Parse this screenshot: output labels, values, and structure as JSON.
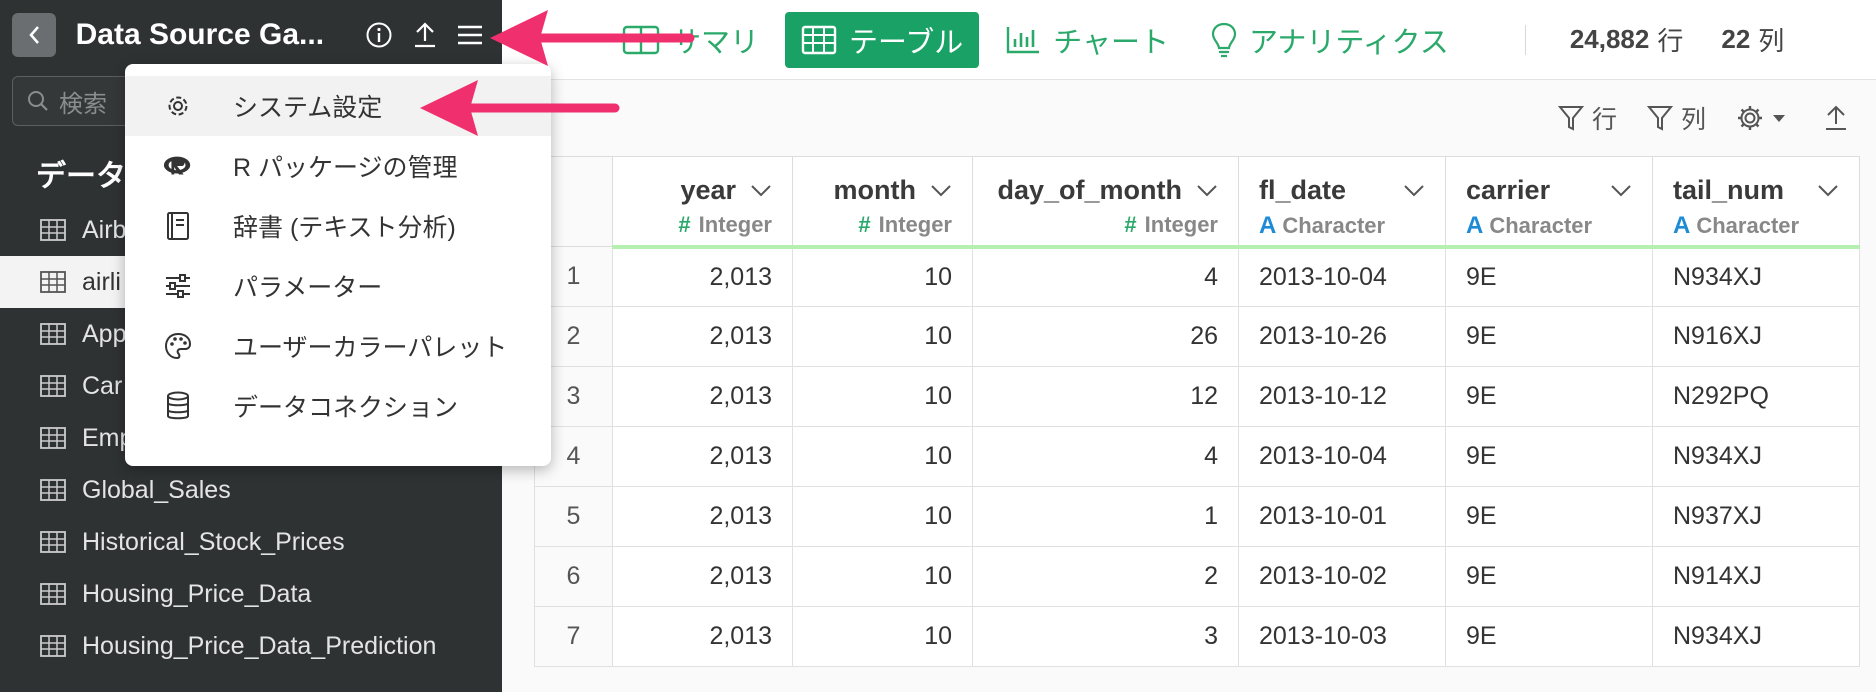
{
  "sidebar": {
    "title": "Data Source Ga...",
    "search_placeholder": "検索",
    "section_label": "データ",
    "items": [
      {
        "label": "Airb"
      },
      {
        "label": "airli"
      },
      {
        "label": "App"
      },
      {
        "label": "Car"
      },
      {
        "label": "Emp"
      },
      {
        "label": "Global_Sales"
      },
      {
        "label": "Historical_Stock_Prices"
      },
      {
        "label": "Housing_Price_Data"
      },
      {
        "label": "Housing_Price_Data_Prediction"
      }
    ]
  },
  "menu": {
    "items": [
      {
        "label": "システム設定",
        "icon": "gear-icon"
      },
      {
        "label": "R パッケージの管理",
        "icon": "r-logo-icon"
      },
      {
        "label": "辞書 (テキスト分析)",
        "icon": "book-icon"
      },
      {
        "label": "パラメーター",
        "icon": "sliders-icon"
      },
      {
        "label": "ユーザーカラーパレット",
        "icon": "palette-icon"
      },
      {
        "label": "データコネクション",
        "icon": "database-icon"
      }
    ]
  },
  "tabs": [
    {
      "label": "サマリ",
      "icon": "summary-icon"
    },
    {
      "label": "テーブル",
      "icon": "table-icon",
      "active": true
    },
    {
      "label": "チャート",
      "icon": "bar-chart-icon"
    },
    {
      "label": "アナリティクス",
      "icon": "bulb-icon"
    }
  ],
  "stats": {
    "rows_value": "24,882",
    "rows_unit": "行",
    "cols_value": "22",
    "cols_unit": "列"
  },
  "toolbar": {
    "row_filter": "行",
    "col_filter": "列"
  },
  "table": {
    "columns": [
      {
        "name": "year",
        "type": "Integer",
        "type_symbol": "#"
      },
      {
        "name": "month",
        "type": "Integer",
        "type_symbol": "#"
      },
      {
        "name": "day_of_month",
        "type": "Integer",
        "type_symbol": "#"
      },
      {
        "name": "fl_date",
        "type": "Character",
        "type_symbol": "A"
      },
      {
        "name": "carrier",
        "type": "Character",
        "type_symbol": "A"
      },
      {
        "name": "tail_num",
        "type": "Character",
        "type_symbol": "A"
      }
    ],
    "rows": [
      {
        "idx": "1",
        "cells": [
          "2,013",
          "10",
          "4",
          "2013-10-04",
          "9E",
          "N934XJ"
        ]
      },
      {
        "idx": "2",
        "cells": [
          "2,013",
          "10",
          "26",
          "2013-10-26",
          "9E",
          "N916XJ"
        ]
      },
      {
        "idx": "3",
        "cells": [
          "2,013",
          "10",
          "12",
          "2013-10-12",
          "9E",
          "N292PQ"
        ]
      },
      {
        "idx": "4",
        "cells": [
          "2,013",
          "10",
          "4",
          "2013-10-04",
          "9E",
          "N934XJ"
        ]
      },
      {
        "idx": "5",
        "cells": [
          "2,013",
          "10",
          "1",
          "2013-10-01",
          "9E",
          "N937XJ"
        ]
      },
      {
        "idx": "6",
        "cells": [
          "2,013",
          "10",
          "2",
          "2013-10-02",
          "9E",
          "N914XJ"
        ]
      },
      {
        "idx": "7",
        "cells": [
          "2,013",
          "10",
          "3",
          "2013-10-03",
          "9E",
          "N934XJ"
        ]
      }
    ]
  },
  "colors": {
    "accent_green": "#1aa266",
    "annotation_pink": "#f0306e",
    "sidebar_bg": "#2f3233"
  }
}
